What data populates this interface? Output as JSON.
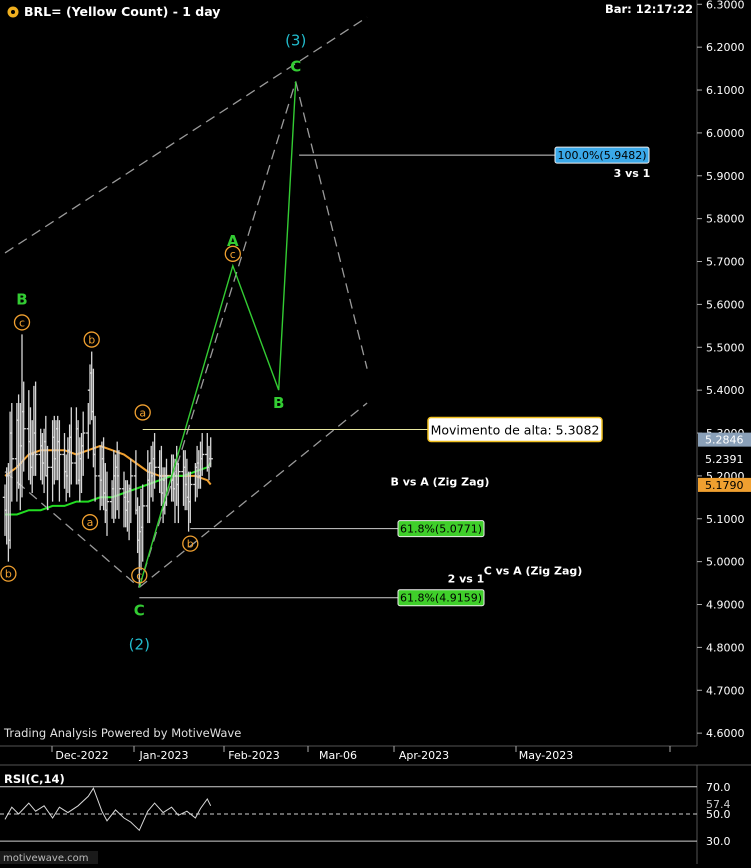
{
  "header": {
    "title": "BRL= (Yellow Count) - 1 day",
    "bar_time": "Bar: 12:17:22",
    "brand_watermark": "Trading Analysis Powered by MotiveWave",
    "footer_logo": "motivewave.com"
  },
  "colors": {
    "background": "#000000",
    "candles": "#d8d8d8",
    "ema_fast": "#f0a030",
    "ema_slow": "#22dd22",
    "wave_primary": "#33cc33",
    "wave_intermediate": "#f0a030",
    "wave_cycle": "#22bbcc",
    "channel": "#9a9a9a",
    "rsi": "#d8d8d8"
  },
  "chart_data": {
    "type": "line",
    "price_axis": {
      "ticks": [
        "6.3000",
        "6.2000",
        "6.1000",
        "6.0000",
        "5.9000",
        "5.8000",
        "5.7000",
        "5.6000",
        "5.5000",
        "5.4000",
        "5.3000",
        "5.2000",
        "5.1000",
        "5.0000",
        "4.9000",
        "4.8000",
        "4.7000",
        "4.6000"
      ],
      "ylim": [
        4.57,
        6.31
      ]
    },
    "time_axis": {
      "labels": [
        "Dec-2022",
        "Jan-2023",
        "Feb-2023",
        "Mar-06",
        "Apr-2023",
        "May-2023"
      ]
    },
    "price_labels": {
      "last_high": "5.2846",
      "last_close": "5.2391",
      "ema_fast_value": "5.1790"
    },
    "series": [
      {
        "type": "candles",
        "x": [
          "2022-11-14",
          "2022-11-15",
          "2022-11-16",
          "2022-11-17",
          "2022-11-18",
          "2022-11-21",
          "2022-11-22",
          "2022-11-23",
          "2022-11-24",
          "2022-11-25",
          "2022-11-28",
          "2022-11-29",
          "2022-11-30",
          "2022-12-01",
          "2022-12-02",
          "2022-12-05",
          "2022-12-06",
          "2022-12-07",
          "2022-12-08",
          "2022-12-09",
          "2022-12-12",
          "2022-12-13",
          "2022-12-14",
          "2022-12-15",
          "2022-12-16",
          "2022-12-19",
          "2022-12-20",
          "2022-12-21",
          "2022-12-22",
          "2022-12-23",
          "2022-12-26",
          "2022-12-27",
          "2022-12-28",
          "2022-12-29",
          "2022-12-30",
          "2023-01-02",
          "2023-01-03",
          "2023-01-04",
          "2023-01-05",
          "2023-01-06",
          "2023-01-09",
          "2023-01-10",
          "2023-01-11",
          "2023-01-12",
          "2023-01-13",
          "2023-01-16",
          "2023-01-17",
          "2023-01-18",
          "2023-01-19",
          "2023-01-20",
          "2023-01-23",
          "2023-01-24",
          "2023-01-25",
          "2023-01-26",
          "2023-01-27",
          "2023-01-30",
          "2023-01-31",
          "2023-02-01",
          "2023-02-02",
          "2023-02-03",
          "2023-02-06",
          "2023-02-07",
          "2023-02-08",
          "2023-02-09",
          "2023-02-10",
          "2023-02-13",
          "2023-02-14",
          "2023-02-15",
          "2023-02-16",
          "2023-02-17",
          "2023-02-20",
          "2023-02-21",
          "2023-02-22",
          "2023-02-23",
          "2023-02-24",
          "2023-02-27",
          "2023-02-28",
          "2023-03-01",
          "2023-03-02",
          "2023-03-03",
          "2023-03-06",
          "2023-03-07",
          "2023-03-08",
          "2023-03-09",
          "2023-03-10",
          "2023-03-13",
          "2023-03-14",
          "2023-03-15"
        ],
        "open": [
          5.15,
          5.12,
          5.2,
          5.05,
          5.3,
          5.24,
          5.33,
          5.18,
          5.27,
          5.35,
          5.31,
          5.28,
          5.22,
          5.25,
          5.3,
          5.25,
          5.27,
          5.23,
          5.28,
          5.2,
          5.22,
          5.29,
          5.24,
          5.31,
          5.28,
          5.25,
          5.21,
          5.2,
          5.26,
          5.29,
          5.23,
          5.31,
          5.19,
          5.24,
          5.27,
          5.3,
          5.4,
          5.44,
          5.35,
          5.25,
          5.2,
          5.19,
          5.24,
          5.16,
          5.12,
          5.14,
          5.17,
          5.2,
          5.22,
          5.2,
          5.17,
          5.15,
          5.12,
          5.14,
          5.17,
          5.2,
          5.12,
          5.05,
          5.07,
          5.08,
          5.13,
          5.19,
          5.23,
          5.2,
          5.24,
          5.22,
          5.2,
          5.16,
          5.19,
          5.2,
          5.2,
          5.19,
          5.17,
          5.2,
          5.18,
          5.21,
          5.22,
          5.18,
          5.15,
          5.14,
          5.18,
          5.22,
          5.23,
          5.2,
          5.24,
          5.25,
          5.22,
          5.24
        ],
        "high": [
          5.18,
          5.22,
          5.23,
          5.35,
          5.37,
          5.37,
          5.39,
          5.37,
          5.53,
          5.42,
          5.4,
          5.36,
          5.33,
          5.41,
          5.42,
          5.31,
          5.3,
          5.31,
          5.34,
          5.27,
          5.33,
          5.34,
          5.33,
          5.34,
          5.33,
          5.3,
          5.25,
          5.29,
          5.32,
          5.36,
          5.36,
          5.33,
          5.29,
          5.3,
          5.35,
          5.37,
          5.46,
          5.49,
          5.45,
          5.34,
          5.27,
          5.28,
          5.29,
          5.23,
          5.21,
          5.19,
          5.26,
          5.25,
          5.28,
          5.26,
          5.21,
          5.19,
          5.19,
          5.18,
          5.24,
          5.26,
          5.15,
          5.13,
          5.17,
          5.18,
          5.26,
          5.23,
          5.27,
          5.28,
          5.3,
          5.26,
          5.27,
          5.22,
          5.22,
          5.24,
          5.25,
          5.25,
          5.24,
          5.27,
          5.23,
          5.26,
          5.26,
          5.24,
          5.21,
          5.21,
          5.23,
          5.27,
          5.26,
          5.28,
          5.3,
          5.3,
          5.27,
          5.29
        ],
        "low": [
          5.06,
          5.04,
          5.0,
          5.03,
          5.14,
          5.14,
          5.17,
          5.12,
          5.15,
          5.21,
          5.19,
          5.18,
          5.16,
          5.2,
          5.2,
          5.19,
          5.18,
          5.16,
          5.2,
          5.12,
          5.14,
          5.18,
          5.19,
          5.19,
          5.14,
          5.17,
          5.14,
          5.16,
          5.15,
          5.18,
          5.18,
          5.18,
          5.14,
          5.16,
          5.2,
          5.24,
          5.32,
          5.33,
          5.22,
          5.14,
          5.12,
          5.13,
          5.12,
          5.09,
          5.06,
          5.1,
          5.09,
          5.1,
          5.12,
          5.1,
          5.08,
          5.08,
          5.07,
          5.05,
          5.09,
          5.11,
          5.02,
          4.94,
          4.98,
          5.0,
          5.09,
          5.09,
          5.15,
          5.14,
          5.17,
          5.16,
          5.13,
          5.09,
          5.11,
          5.13,
          5.14,
          5.14,
          5.09,
          5.13,
          5.09,
          5.13,
          5.12,
          5.12,
          5.07,
          5.09,
          5.14,
          5.15,
          5.17,
          5.17,
          5.2,
          5.21,
          5.19,
          5.22
        ],
        "close": [
          5.12,
          5.2,
          5.05,
          5.3,
          5.24,
          5.33,
          5.18,
          5.27,
          5.35,
          5.31,
          5.28,
          5.22,
          5.25,
          5.3,
          5.25,
          5.27,
          5.23,
          5.28,
          5.2,
          5.22,
          5.29,
          5.24,
          5.31,
          5.28,
          5.25,
          5.21,
          5.2,
          5.26,
          5.29,
          5.23,
          5.31,
          5.19,
          5.24,
          5.27,
          5.3,
          5.4,
          5.44,
          5.35,
          5.25,
          5.2,
          5.19,
          5.24,
          5.16,
          5.12,
          5.14,
          5.17,
          5.2,
          5.22,
          5.2,
          5.17,
          5.15,
          5.12,
          5.14,
          5.17,
          5.2,
          5.12,
          5.05,
          5.07,
          5.08,
          5.13,
          5.19,
          5.23,
          5.2,
          5.24,
          5.22,
          5.2,
          5.16,
          5.19,
          5.2,
          5.2,
          5.19,
          5.17,
          5.2,
          5.18,
          5.21,
          5.22,
          5.18,
          5.15,
          5.14,
          5.18,
          5.22,
          5.23,
          5.2,
          5.24,
          5.25,
          5.22,
          5.24,
          5.24
        ]
      },
      {
        "name": "ema_fast",
        "type": "line",
        "x": [
          "2022-11-14",
          "2022-11-21",
          "2022-11-28",
          "2022-12-05",
          "2022-12-12",
          "2022-12-19",
          "2022-12-26",
          "2023-01-02",
          "2023-01-09",
          "2023-01-16",
          "2023-01-23",
          "2023-01-30",
          "2023-02-06",
          "2023-02-13",
          "2023-02-20",
          "2023-02-27",
          "2023-03-06",
          "2023-03-13",
          "2023-03-15"
        ],
        "y": [
          5.2,
          5.22,
          5.25,
          5.26,
          5.26,
          5.26,
          5.25,
          5.26,
          5.27,
          5.26,
          5.25,
          5.23,
          5.21,
          5.2,
          5.2,
          5.2,
          5.2,
          5.19,
          5.18
        ]
      },
      {
        "name": "ema_slow",
        "type": "line",
        "x": [
          "2022-11-14",
          "2022-11-21",
          "2022-11-28",
          "2022-12-05",
          "2022-12-12",
          "2022-12-19",
          "2022-12-26",
          "2023-01-02",
          "2023-01-09",
          "2023-01-16",
          "2023-01-23",
          "2023-01-30",
          "2023-02-06",
          "2023-02-13",
          "2023-02-20",
          "2023-02-27",
          "2023-03-06",
          "2023-03-13",
          "2023-03-15"
        ],
        "y": [
          5.11,
          5.11,
          5.12,
          5.12,
          5.13,
          5.13,
          5.14,
          5.14,
          5.15,
          5.15,
          5.16,
          5.17,
          5.18,
          5.19,
          5.2,
          5.2,
          5.21,
          5.22,
          5.23
        ]
      }
    ],
    "elliott_waves": {
      "primary_labels": [
        {
          "text": "B",
          "date": "2022-11-24",
          "price": 5.53,
          "above": true
        },
        {
          "text": "C",
          "date": "2023-02-01",
          "price": 4.94,
          "above": false
        },
        {
          "text": "A",
          "date": "2023-03-28",
          "price": 5.69,
          "above": true
        },
        {
          "text": "B",
          "date": "2023-04-24",
          "price": 5.4,
          "above": false
        },
        {
          "text": "C",
          "date": "2023-05-04",
          "price": 6.12,
          "above": true
        }
      ],
      "intermediate_labels": [
        {
          "text": "b",
          "date": "2022-11-16",
          "price": 5.0,
          "above": false
        },
        {
          "text": "c",
          "date": "2022-11-24",
          "price": 5.53,
          "above": true
        },
        {
          "text": "b",
          "date": "2023-01-04",
          "price": 5.49,
          "above": true
        },
        {
          "text": "a",
          "date": "2023-01-03",
          "price": 5.12,
          "above": false
        },
        {
          "text": "c",
          "date": "2023-02-01",
          "price": 4.94,
          "above": true
        },
        {
          "text": "a",
          "date": "2023-02-03",
          "price": 5.32,
          "above": true
        },
        {
          "text": "b",
          "date": "2023-03-03",
          "price": 5.07,
          "above": false
        },
        {
          "text": "c",
          "date": "2023-03-28",
          "price": 5.69,
          "above": true
        }
      ],
      "cycle_labels": [
        {
          "text": "(2)",
          "date": "2023-02-01",
          "price": 4.94,
          "above": false
        },
        {
          "text": "(3)",
          "date": "2023-05-04",
          "price": 6.12,
          "above": true
        }
      ],
      "projection_path": {
        "dates": [
          "2023-02-01",
          "2023-03-28",
          "2023-04-24",
          "2023-05-04"
        ],
        "prices": [
          4.94,
          5.69,
          5.4,
          6.12
        ]
      },
      "dashed_guides": [
        {
          "dates": [
            "2023-02-01",
            "2023-05-04"
          ],
          "prices": [
            4.94,
            6.12
          ]
        },
        {
          "dates": [
            "2023-05-04",
            "2023-06-15"
          ],
          "prices": [
            6.12,
            5.45
          ]
        }
      ],
      "channel_lines": [
        {
          "dates": [
            "2022-11-14",
            "2023-06-15"
          ],
          "prices": [
            5.72,
            6.27
          ]
        },
        {
          "dates": [
            "2023-02-01",
            "2023-06-15"
          ],
          "prices": [
            4.94,
            5.37
          ]
        },
        {
          "dates": [
            "2022-11-14",
            "2023-02-01"
          ],
          "prices": [
            5.21,
            4.94
          ]
        }
      ]
    },
    "annotations": {
      "movement_label": "Movimento de alta: 5.3082",
      "movement_price": 5.3082,
      "movement_from_date": "2023-02-03",
      "fib_upper": {
        "text": "100.0%(5.9482)",
        "price": 5.9482,
        "from_date": "2023-05-06",
        "tag": "3 vs 1"
      },
      "fib_mid": {
        "text": "61.8%(5.0771)",
        "price": 5.0771,
        "from_date": "2023-03-03",
        "tag": "B vs A (Zig Zag)"
      },
      "fib_low": {
        "text": "61.8%(4.9159)",
        "price": 4.9159,
        "from_date": "2023-02-01",
        "tag": "2 vs 1",
        "tag2": "C vs A (Zig Zag)"
      }
    },
    "rsi": {
      "title": "RSI(C,14)",
      "ylim": [
        22,
        75
      ],
      "levels": [
        "70.0",
        "50.0",
        "30.0"
      ],
      "current_value": "57.4",
      "x": [
        "2022-11-14",
        "2022-11-18",
        "2022-11-22",
        "2022-11-28",
        "2022-12-02",
        "2022-12-07",
        "2022-12-12",
        "2022-12-16",
        "2022-12-21",
        "2022-12-27",
        "2023-01-02",
        "2023-01-05",
        "2023-01-10",
        "2023-01-13",
        "2023-01-18",
        "2023-01-23",
        "2023-01-27",
        "2023-02-01",
        "2023-02-06",
        "2023-02-10",
        "2023-02-15",
        "2023-02-20",
        "2023-02-24",
        "2023-03-01",
        "2023-03-06",
        "2023-03-09",
        "2023-03-13",
        "2023-03-15"
      ],
      "y": [
        46,
        55,
        50,
        58,
        52,
        56,
        47,
        55,
        51,
        56,
        63,
        69,
        52,
        45,
        53,
        47,
        44,
        38,
        52,
        58,
        51,
        55,
        49,
        52,
        47,
        54,
        61,
        56
      ]
    }
  }
}
